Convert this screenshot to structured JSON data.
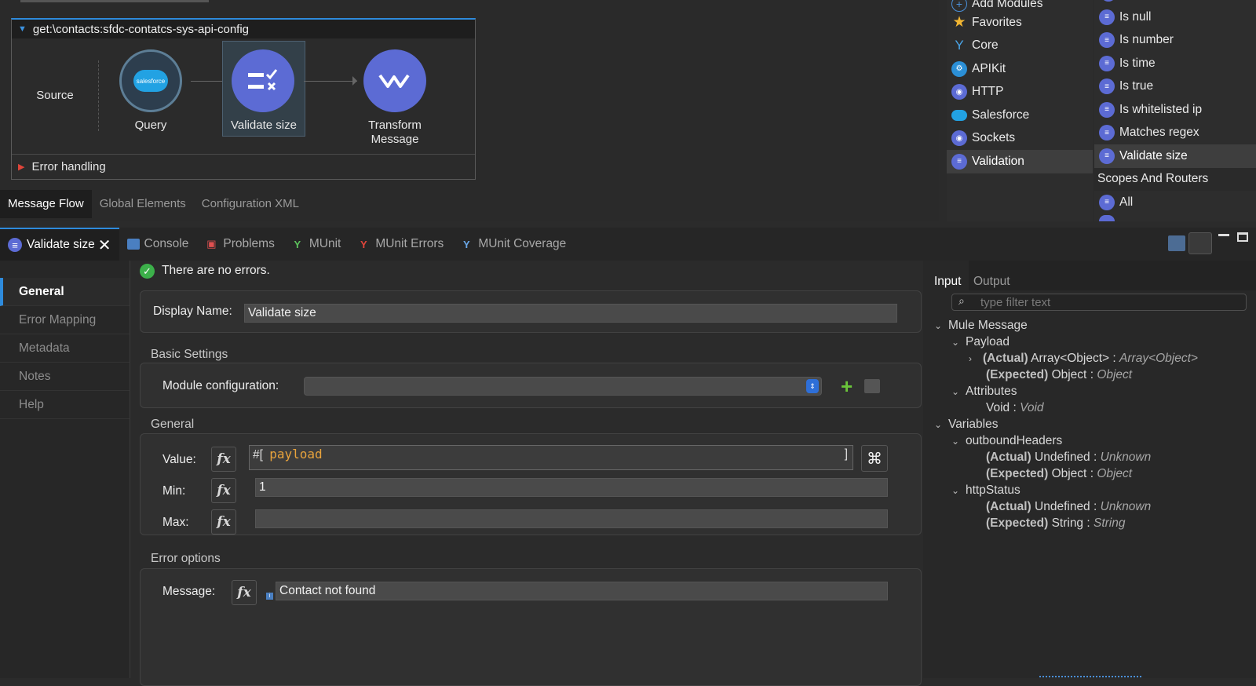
{
  "flow": {
    "title": "get:\\contacts:sfdc-contatcs-sys-api-config",
    "source_label": "Source",
    "nodes": [
      {
        "label": "Query",
        "icon": "salesforce-icon",
        "icon_text": "salesforce"
      },
      {
        "label": "Validate size",
        "icon": "validate-icon"
      },
      {
        "label": "Transform Message",
        "icon": "transform-icon"
      }
    ],
    "error_handling": "Error handling"
  },
  "canvas_tabs": [
    "Message Flow",
    "Global Elements",
    "Configuration XML"
  ],
  "palette": {
    "modules": [
      {
        "label": "Add Modules",
        "icon": "plus-circle-icon"
      },
      {
        "label": "Favorites",
        "icon": "star-icon"
      },
      {
        "label": "Core",
        "icon": "core-icon"
      },
      {
        "label": "APIKit",
        "icon": "apikit-icon"
      },
      {
        "label": "HTTP",
        "icon": "http-icon"
      },
      {
        "label": "Salesforce",
        "icon": "salesforce-icon"
      },
      {
        "label": "Sockets",
        "icon": "sockets-icon"
      },
      {
        "label": "Validation",
        "icon": "validation-icon"
      }
    ],
    "operations": [
      "Is null",
      "Is number",
      "Is time",
      "Is true",
      "Is whitelisted ip",
      "Matches regex",
      "Validate size"
    ],
    "section": "Scopes And Routers",
    "after_section": [
      "All"
    ]
  },
  "bottom_tabs": [
    "Validate size",
    "Console",
    "Problems",
    "MUnit",
    "MUnit Errors",
    "MUnit Coverage"
  ],
  "left_nav": [
    "General",
    "Error Mapping",
    "Metadata",
    "Notes",
    "Help"
  ],
  "status": "There are no errors.",
  "form": {
    "display_name_label": "Display Name:",
    "display_name_value": "Validate size",
    "basic_settings": "Basic Settings",
    "module_config_label": "Module configuration:",
    "module_config_value": "",
    "general_title": "General",
    "value_label": "Value:",
    "value_prefix": "#[",
    "value_expr": "payload",
    "value_suffix": "]",
    "min_label": "Min:",
    "min_value": "1",
    "max_label": "Max:",
    "max_value": "",
    "error_options": "Error options",
    "message_label": "Message:",
    "message_value": "Contact not found",
    "fx": "fx"
  },
  "metadata": {
    "tab_input": "Input",
    "tab_output": "Output",
    "filter_placeholder": "type filter text",
    "mule_message": "Mule Message",
    "payload": "Payload",
    "payload_actual_b": "(Actual)",
    "payload_actual_t": "Array<Object>",
    "payload_actual_i": "Array<Object>",
    "payload_expected_b": "(Expected)",
    "payload_expected_t": "Object",
    "payload_expected_i": "Object",
    "attributes": "Attributes",
    "attr_t": "Void",
    "attr_i": "Void",
    "variables": "Variables",
    "outbound": "outboundHeaders",
    "ob_actual_t": "Undefined",
    "ob_actual_i": "Unknown",
    "ob_expected_t": "Object",
    "ob_expected_i": "Object",
    "http": "httpStatus",
    "hs_actual_t": "Undefined",
    "hs_actual_i": "Unknown",
    "hs_expected_t": "String",
    "hs_expected_i": "String",
    "sep": ":"
  },
  "colors": {
    "accent": "#2e8bdc",
    "node_purple": "#5c6bd4",
    "expr_orange": "#e8a33c",
    "ok_green": "#3cb04a"
  }
}
